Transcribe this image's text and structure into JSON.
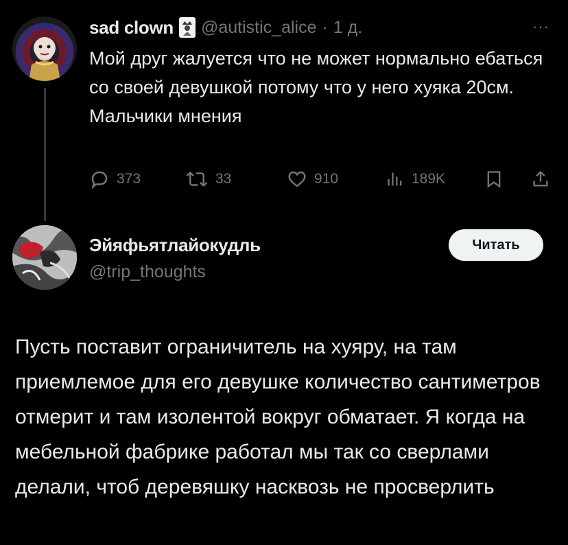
{
  "tweet": {
    "display_name": "sad clown",
    "handle": "@autistic_alice",
    "separator": "·",
    "time": "1 д.",
    "more": "···",
    "text": "Мой друг жалуется что не может нормально ебаться со своей девушкой потому что у него хуяка 20см.\nМальчики мнения",
    "actions": {
      "replies": "373",
      "retweets": "33",
      "likes": "910",
      "views": "189K"
    }
  },
  "reply": {
    "display_name": "Эйяфьятлайокудль",
    "handle": "@trip_thoughts",
    "follow_label": "Читать",
    "text": "Пусть поставит ограничитель на хуяру, на там приемлемое для его девушке количество сантиметров отмерит и там изолентой вокруг обматает. Я когда на мебельной фабрике работал мы так со сверлами делали, чтоб деревяшку насквозь не просверлить"
  },
  "colors": {
    "background": "#000000",
    "text": "#e7e9ea",
    "muted": "#71767b",
    "follow_bg": "#eff3f4"
  },
  "icons": [
    "reply-icon",
    "retweet-icon",
    "like-icon",
    "views-icon",
    "bookmark-icon",
    "share-icon",
    "jester-card-icon",
    "more-icon"
  ]
}
